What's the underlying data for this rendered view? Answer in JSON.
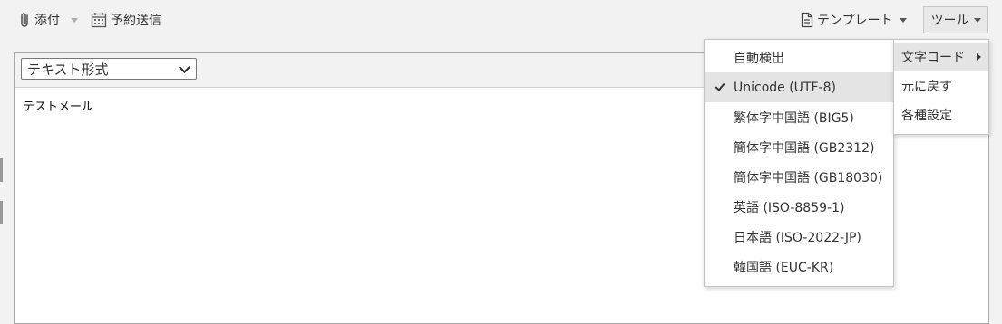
{
  "toolbar": {
    "attach_label": "添付",
    "schedule_label": "予約送信",
    "template_label": "テンプレート",
    "tools_label": "ツール"
  },
  "editor": {
    "format_value": "テキスト形式",
    "body_text": "テストメール"
  },
  "encoding_menu": {
    "items": [
      {
        "label": "自動検出",
        "selected": false
      },
      {
        "label": "Unicode (UTF-8)",
        "selected": true
      },
      {
        "label": "繁体字中国語 (BIG5)",
        "selected": false
      },
      {
        "label": "簡体字中国語 (GB2312)",
        "selected": false
      },
      {
        "label": "簡体字中国語 (GB18030)",
        "selected": false
      },
      {
        "label": "英語 (ISO-8859-1)",
        "selected": false
      },
      {
        "label": "日本語 (ISO-2022-JP)",
        "selected": false
      },
      {
        "label": "韓国語 (EUC-KR)",
        "selected": false
      }
    ]
  },
  "tools_menu": {
    "items": [
      {
        "label": "文字コード"
      },
      {
        "label": "元に戻す"
      },
      {
        "label": "各種設定"
      }
    ]
  },
  "icons": {
    "attach": "paperclip-icon",
    "schedule": "calendar-icon",
    "template": "document-icon",
    "selected_mark": "check-icon",
    "submenu": "chevron-right-icon"
  }
}
